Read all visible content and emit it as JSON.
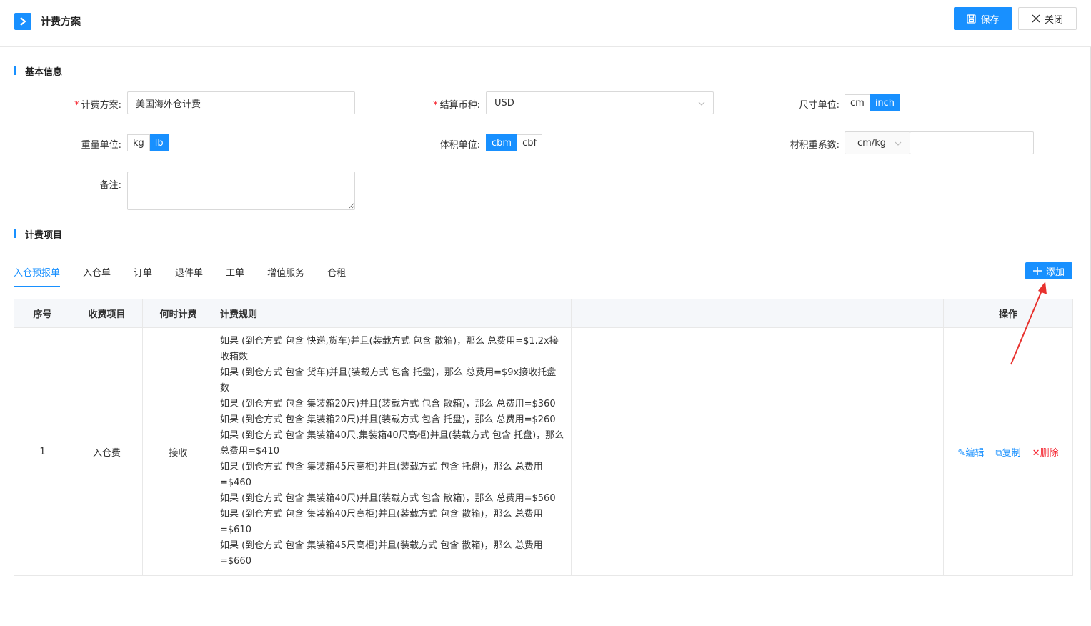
{
  "header": {
    "title": "计费方案",
    "save_label": "保存",
    "close_label": "关闭"
  },
  "basic_info": {
    "section_title": "基本信息",
    "plan_label": "计费方案:",
    "plan_value": "美国海外仓计费",
    "currency_label": "结算币种:",
    "currency_value": "USD",
    "size_unit_label": "尺寸单位:",
    "size_units": [
      "cm",
      "inch"
    ],
    "size_unit_selected": "inch",
    "weight_unit_label": "重量单位:",
    "weight_units": [
      "kg",
      "lb"
    ],
    "weight_unit_selected": "lb",
    "volume_unit_label": "体积单位:",
    "volume_units": [
      "cbm",
      "cbf"
    ],
    "volume_unit_selected": "cbm",
    "dim_factor_label": "材积重系数:",
    "dim_factor_unit": "cm/kg",
    "dim_factor_value": "",
    "remark_label": "备注:"
  },
  "fee_items": {
    "section_title": "计费项目",
    "tabs": [
      "入仓预报单",
      "入仓单",
      "订单",
      "退件单",
      "工单",
      "增值服务",
      "仓租"
    ],
    "active_tab": "入仓预报单",
    "add_label": "添加",
    "table": {
      "headers": [
        "序号",
        "收费项目",
        "何时计费",
        "计费规则",
        "",
        "操作"
      ],
      "rows": [
        {
          "index": "1",
          "item": "入仓费",
          "when": "接收",
          "rules": [
            "如果 (到仓方式 包含 快递,货车)并且(装载方式 包含 散箱)，那么 总费用=$1.2x接收箱数",
            "如果 (到仓方式 包含 货车)并且(装载方式 包含 托盘)，那么 总费用=$9x接收托盘数",
            "如果 (到仓方式 包含 集装箱20尺)并且(装载方式 包含 散箱)，那么 总费用=$360",
            "如果 (到仓方式 包含 集装箱20尺)并且(装载方式 包含 托盘)，那么 总费用=$260",
            "如果 (到仓方式 包含 集装箱40尺,集装箱40尺高柜)并且(装载方式 包含 托盘)，那么 总费用=$410",
            "如果 (到仓方式 包含 集装箱45尺高柜)并且(装载方式 包含 托盘)，那么 总费用=$460",
            "如果 (到仓方式 包含 集装箱40尺)并且(装载方式 包含 散箱)，那么 总费用=$560",
            "如果 (到仓方式 包含 集装箱40尺高柜)并且(装载方式 包含 散箱)，那么 总费用=$610",
            "如果 (到仓方式 包含 集装箱45尺高柜)并且(装载方式 包含 散箱)，那么 总费用=$660"
          ],
          "ops": [
            "编辑",
            "复制",
            "删除"
          ]
        }
      ]
    }
  },
  "colors": {
    "primary": "#1890ff",
    "danger": "#f5222d",
    "annotation_arrow": "#e8322e"
  }
}
